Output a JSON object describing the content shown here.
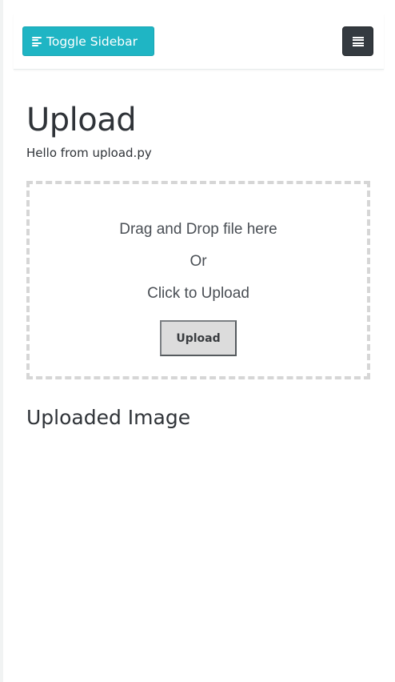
{
  "navbar": {
    "toggle_sidebar_label": "Toggle Sidebar",
    "toggle_sidebar_icon": "align-left-icon",
    "menu_icon": "hamburger-menu-icon"
  },
  "main": {
    "title": "Upload",
    "subtitle": "Hello from upload.py",
    "dropzone": {
      "line1": "Drag and Drop file here",
      "line2": "Or",
      "line3": "Click to Upload",
      "button_label": "Upload"
    },
    "uploaded_section_title": "Uploaded Image"
  },
  "colors": {
    "accent": "#1fb5c4",
    "dark_button": "#343a40",
    "dropzone_border": "#d6d6d6",
    "text": "#2f3338"
  }
}
